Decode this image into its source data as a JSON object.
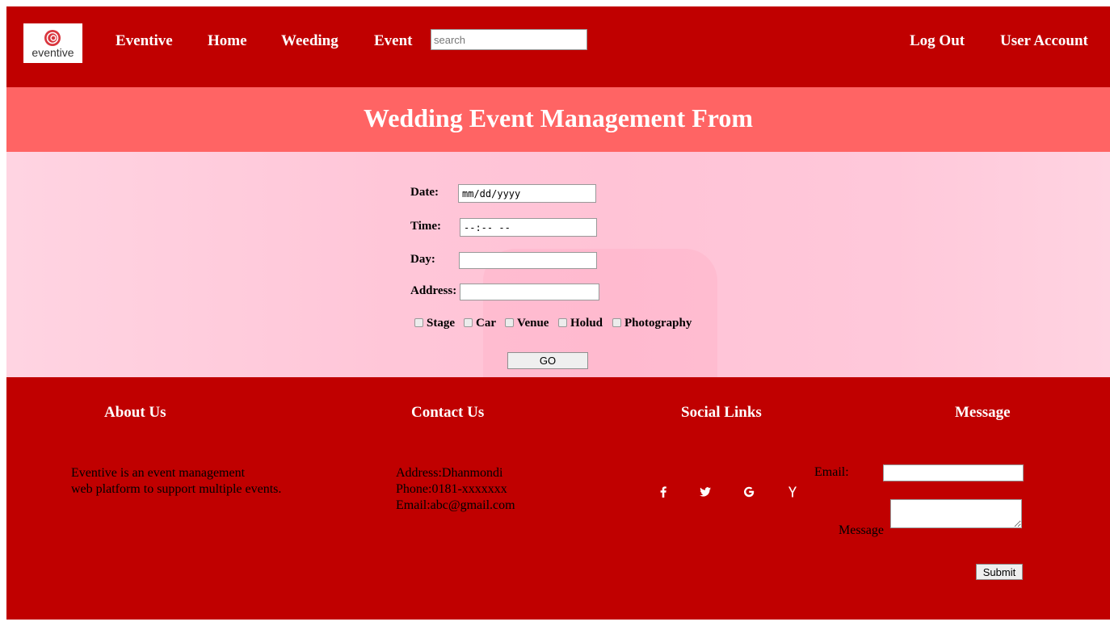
{
  "header": {
    "logo_text": "eventive",
    "nav": {
      "eventive": "Eventive",
      "home": "Home",
      "weeding": "Weeding",
      "event": "Event"
    },
    "search_placeholder": "search",
    "logout": "Log Out",
    "user_account": "User Account"
  },
  "title": "Wedding Event Management From",
  "form": {
    "date_label": "Date:",
    "date_placeholder": "mm/dd/yyyy",
    "time_label": "Time:",
    "time_placeholder": "--:-- --",
    "day_label": "Day:",
    "address_label": "Address:",
    "options": [
      "Stage",
      "Car",
      "Venue",
      "Holud",
      "Photography"
    ],
    "go_label": "GO"
  },
  "footer": {
    "about": {
      "heading": "About Us",
      "line1": "Eventive is an event management",
      "line2": "web platform to support multiple events."
    },
    "contact": {
      "heading": "Contact Us",
      "address": "Address:Dhanmondi",
      "phone": "Phone:0181-xxxxxxx",
      "email": "Email:abc@gmail.com"
    },
    "social": {
      "heading": "Social Links",
      "icons": [
        "facebook-icon",
        "twitter-icon",
        "google-icon",
        "y-combinator-icon"
      ]
    },
    "message": {
      "heading": "Message",
      "email_label": "Email:",
      "message_label": "Message",
      "submit_label": "Submit"
    }
  },
  "colors": {
    "header_bg": "#c00000",
    "title_band_bg": "#ff6464",
    "form_bg": "#ffc6d8",
    "footer_bg": "#c00000"
  }
}
